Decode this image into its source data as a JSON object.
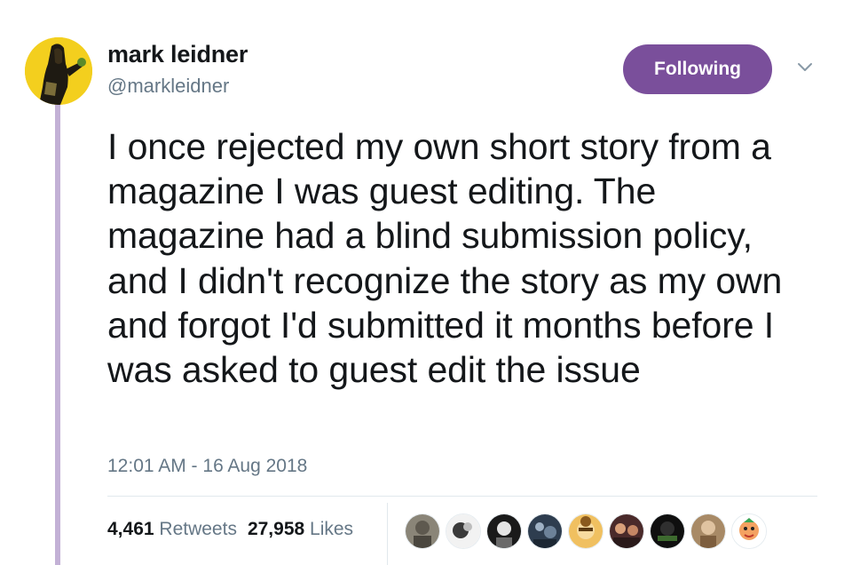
{
  "tweet": {
    "author": {
      "name": "mark leidner",
      "handle": "@markleidner"
    },
    "follow_label": "Following",
    "text": "I once rejected my own short story from a magazine I was guest editing. The magazine had a blind submission policy, and I didn't recognize the story as my own and forgot I'd submitted it months before I was asked to guest edit the issue",
    "timestamp": "12:01 AM - 16 Aug 2018",
    "retweets": {
      "count": "4,461",
      "label": "Retweets"
    },
    "likes": {
      "count": "27,958",
      "label": "Likes"
    }
  },
  "colors": {
    "follow_button": "#7a4f9b",
    "thread_line": "#c3b1d6",
    "avatar_bg": "#f3cf1e",
    "secondary_text": "#657786"
  },
  "icons": {
    "menu": "chevron-down-icon"
  }
}
